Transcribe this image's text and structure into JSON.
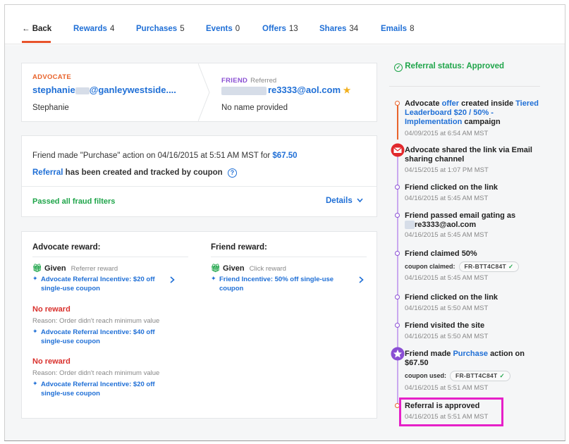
{
  "tabs": [
    {
      "label": "← Back",
      "count": ""
    },
    {
      "label": "Rewards",
      "count": "4"
    },
    {
      "label": "Purchases",
      "count": "5"
    },
    {
      "label": "Events",
      "count": "0"
    },
    {
      "label": "Offers",
      "count": "13"
    },
    {
      "label": "Shares",
      "count": "34"
    },
    {
      "label": "Emails",
      "count": "8"
    }
  ],
  "advocate": {
    "label": "ADVOCATE",
    "email_prefix": "stephanie",
    "email_suffix": "@ganleywestside....",
    "name": "Stephanie"
  },
  "friend": {
    "label": "FRIEND",
    "status": "Referred",
    "email_suffix": "re3333@aol.com",
    "name": "No name provided"
  },
  "action": {
    "text": "Friend made \"Purchase\" action on 04/16/2015 at 5:51 AM MST for",
    "amount": "$67.50",
    "tracked_link": "Referral",
    "tracked_text": "has been created and tracked by coupon",
    "help_icon": "?"
  },
  "fraud": {
    "status": "Passed all fraud filters",
    "details_label": "Details"
  },
  "advocate_reward": {
    "title": "Advocate reward:",
    "given_label": "Given",
    "given_type": "Referrer reward",
    "given_item": "Advocate Referral Incentive: $20 off single-use coupon",
    "no_reward_1": {
      "label": "No reward",
      "reason": "Reason: Order didn't reach minimum value",
      "item": "Advocate Referral Incentive: $40 off single-use coupon"
    },
    "no_reward_2": {
      "label": "No reward",
      "reason": "Reason: Order didn't reach minimum value",
      "item": "Advocate Referral Incentive: $20 off single-use coupon"
    }
  },
  "friend_reward": {
    "title": "Friend reward:",
    "given_label": "Given",
    "given_type": "Click reward",
    "given_item": "Friend Incentive: 50% off single-use coupon"
  },
  "status": {
    "label": "Referral status: Approved"
  },
  "timeline": {
    "e1_prefix": "Advocate",
    "e1_link": "offer",
    "e1_mid": "created inside",
    "e1_campaign": "Tiered Leaderboard $20 / 50% - Implementation",
    "e1_suffix": "campaign",
    "e1_time": "04/09/2015 at 6:54 AM MST",
    "e2_title": "Advocate shared the link via Email sharing channel",
    "e2_time": "04/15/2015 at 1:07 PM MST",
    "e3_title": "Friend clicked on the link",
    "e3_time": "04/16/2015 at 5:45 AM MST",
    "e4_title": "Friend passed email gating as",
    "e4_email_suffix": "re3333@aol.com",
    "e4_time": "04/16/2015 at 5:45 AM MST",
    "e5_title": "Friend claimed 50%",
    "e5_coupon_label": "coupon claimed:",
    "e5_coupon": "FR-BTT4C84T",
    "e5_time": "04/16/2015 at 5:45 AM MST",
    "e6_title": "Friend clicked on the link",
    "e6_time": "04/16/2015 at 5:50 AM MST",
    "e7_title": "Friend visited the site",
    "e7_time": "04/16/2015 at 5:50 AM MST",
    "e8_prefix": "Friend made",
    "e8_link": "Purchase",
    "e8_suffix": "action on",
    "e8_amount": "$67.50",
    "e8_coupon_label": "coupon used:",
    "e8_coupon": "FR-BTT4C84T",
    "e8_time": "04/16/2015 at 5:51 AM MST",
    "e9_title": "Referral is approved",
    "e9_time": "04/16/2015 at 5:51 AM MST"
  },
  "colors": {
    "accent_blue": "#1f6fd6",
    "advocate_orange": "#e8632b",
    "friend_purple": "#8a4fd3",
    "success_green": "#1fa54a",
    "error_red": "#d9302c",
    "highlight_magenta": "#e620c8"
  }
}
